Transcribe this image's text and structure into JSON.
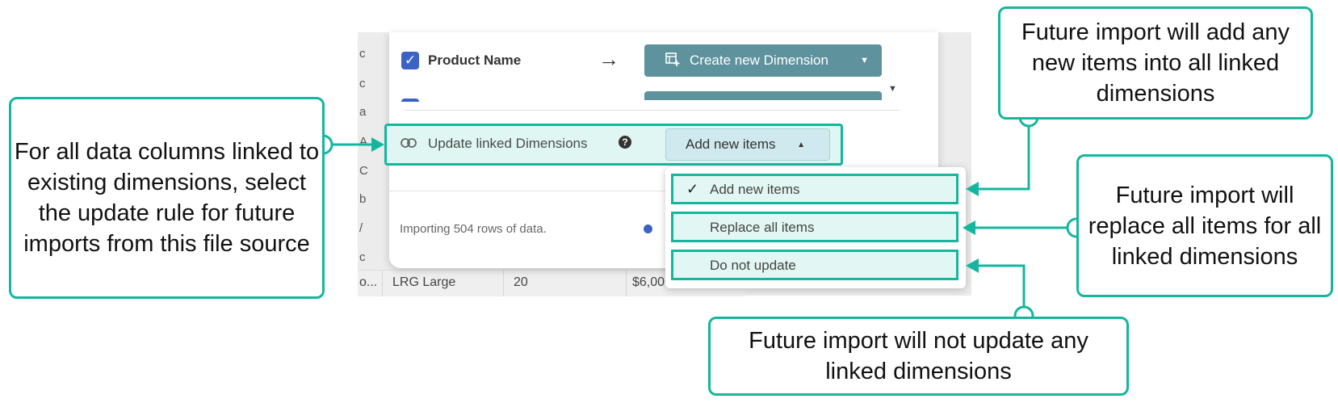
{
  "dialog": {
    "product_name": "Product Name",
    "create_button_label": "Create new Dimension",
    "update_label": "Update linked Dimensions",
    "update_value": "Add new items",
    "importing_text": "Importing 504 rows of data."
  },
  "menu": {
    "items": [
      {
        "label": "Add new items",
        "selected": true
      },
      {
        "label": "Replace all items",
        "selected": false
      },
      {
        "label": "Do not update",
        "selected": false
      }
    ]
  },
  "background_table": {
    "row": [
      "o...",
      "LRG Large",
      "20",
      "$6,00"
    ],
    "left_letters": [
      "c",
      "c",
      "a",
      "A",
      "C",
      "b",
      "/",
      "c"
    ]
  },
  "callouts": {
    "left": "For all data columns linked to existing dimensions, select the update rule for future imports from this file source",
    "top_right": "Future import will add any new items into all linked dimensions",
    "right": "Future import will replace all items for all linked dimensions",
    "bottom": "Future import will not update any linked dimensions"
  },
  "colors": {
    "accent": "#14b79e",
    "button": "#5e929d",
    "checkbox": "#3b63c4",
    "highlight": "#e0f6f2"
  }
}
